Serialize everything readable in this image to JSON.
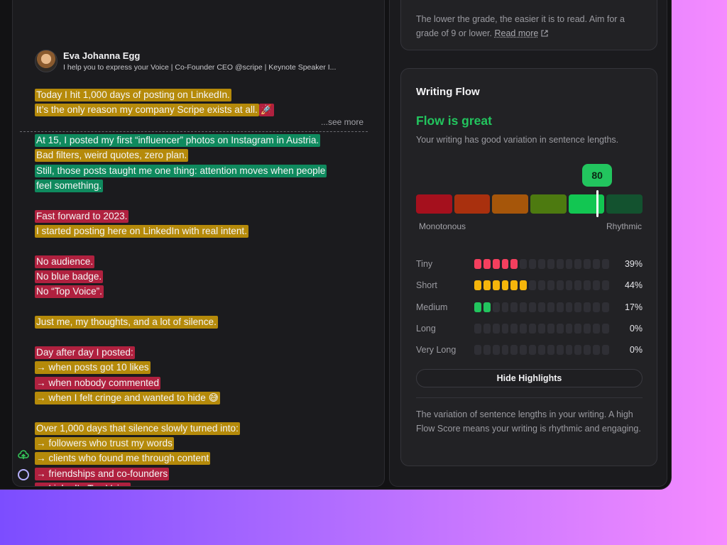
{
  "post": {
    "author_name": "Eva Johanna Egg",
    "author_headline": "I help you to express your Voice | Co-Founder CEO @scripe | Keynote Speaker I...",
    "see_more": "...see more",
    "lines": [
      {
        "text": "Today I hit 1,000 days of posting on LinkedIn.",
        "color": "yellow"
      },
      {
        "text": "It’s the only reason my company Scripe exists at all.",
        "color": "yellow",
        "emoji": "🚀"
      },
      {
        "text": "",
        "color": ""
      },
      {
        "text": "At 15, I posted my first “influencer” photos on Instagram in Austria.",
        "color": "green"
      },
      {
        "text": "Bad filters, weird quotes, zero plan.",
        "color": "yellow"
      },
      {
        "text": "Still, those posts taught me one thing: attention moves when people",
        "color": "green"
      },
      {
        "text": "feel something.",
        "color": "green"
      },
      {
        "text": "",
        "color": ""
      },
      {
        "text": "Fast forward to 2023.",
        "color": "red"
      },
      {
        "text": "I started posting here on LinkedIn with real intent.",
        "color": "yellow"
      },
      {
        "text": "",
        "color": ""
      },
      {
        "text": "No audience.",
        "color": "red"
      },
      {
        "text": "No blue badge.",
        "color": "red"
      },
      {
        "text": "No “Top Voice”.",
        "color": "red"
      },
      {
        "text": "",
        "color": ""
      },
      {
        "text": "Just me, my thoughts, and a lot of silence.",
        "color": "yellow"
      },
      {
        "text": "",
        "color": ""
      },
      {
        "text": "Day after day I posted:",
        "color": "red"
      },
      {
        "text": "→ when posts got 10 likes",
        "color": "yellow"
      },
      {
        "text": "→ when nobody commented",
        "color": "red"
      },
      {
        "text": "→ when I felt cringe and wanted to hide 😅",
        "color": "yellow"
      },
      {
        "text": "",
        "color": ""
      },
      {
        "text": "Over 1,000 days that silence slowly turned into:",
        "color": "yellow"
      },
      {
        "text": "→ followers who trust my words",
        "color": "yellow"
      },
      {
        "text": "→ clients who found me through content",
        "color": "yellow"
      },
      {
        "text": "→ friendships and co-founders",
        "color": "red"
      },
      {
        "text": "→ LinkedIn Top Voice",
        "color": "red"
      }
    ]
  },
  "readability": {
    "text": "The lower the grade, the easier it is to read. Aim for a grade of 9 or lower.",
    "read_more": "Read more"
  },
  "flow": {
    "title": "Writing Flow",
    "status": "Flow is great",
    "description": "Your writing has good variation in sentence lengths.",
    "score": "80",
    "score_fraction": 0.8,
    "meter_colors": [
      "#a5101d",
      "#a9300e",
      "#a6560a",
      "#4d7a10",
      "#12c652",
      "#13522f"
    ],
    "label_left": "Monotonous",
    "label_right": "Rhythmic",
    "distribution": [
      {
        "name": "Tiny",
        "filled": 5,
        "color": "#f43f5e",
        "pct": "39%"
      },
      {
        "name": "Short",
        "filled": 6,
        "color": "#f5b50b",
        "pct": "44%"
      },
      {
        "name": "Medium",
        "filled": 2,
        "color": "#22c55e",
        "pct": "17%"
      },
      {
        "name": "Long",
        "filled": 0,
        "color": "#22c55e",
        "pct": "0%"
      },
      {
        "name": "Very Long",
        "filled": 0,
        "color": "#22c55e",
        "pct": "0%"
      }
    ],
    "total_dots": 15,
    "hide_button": "Hide Highlights",
    "footer": "The variation of sentence lengths in your writing. A high Flow Score means your writing is rhythmic and engaging."
  }
}
